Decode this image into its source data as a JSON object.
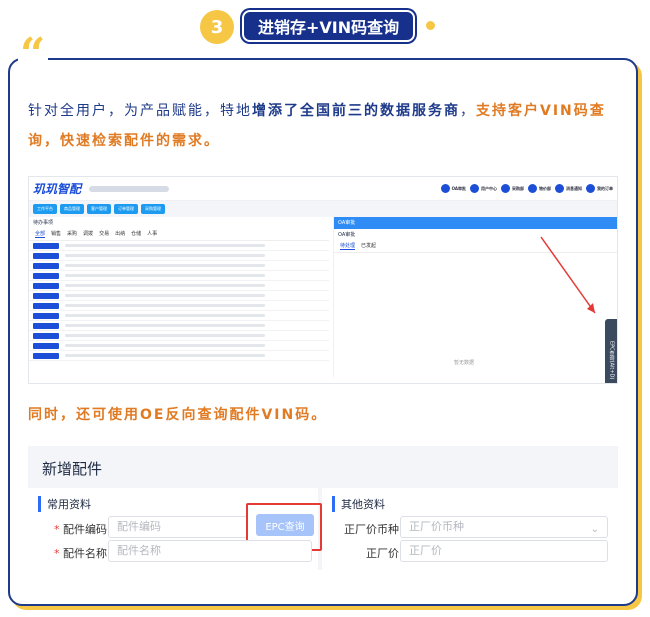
{
  "header": {
    "step_number": "3",
    "title": "进销存+VIN码查询"
  },
  "intro": {
    "part1": "针对全用户，为产品赋能，特地",
    "part2": "增添了全国前三的数据服务商",
    "part3": "，",
    "part4": "支持客户VIN码查询，快速检索配件的需求。"
  },
  "screenshot1": {
    "logo": "玑玑智配",
    "nav": [
      "OA审批",
      "用户中心",
      "采购部",
      "物价部",
      "消息通知",
      "我的订单"
    ],
    "quick_tabs": [
      "工作平台",
      "商品管理",
      "客户管理",
      "订单管理",
      "采购管理"
    ],
    "pending_title": "待办事项",
    "tabs": [
      "全部",
      "销售",
      "采购",
      "调拨",
      "交易",
      "出纳",
      "仓储",
      "人事"
    ],
    "oa_title": "OA审批",
    "oa_sub": "OA审批",
    "oa_tabs": [
      "待处理",
      "已发起"
    ],
    "empty_text": "暂无数据",
    "epc_label": "EPC查询(Alt+D)"
  },
  "line2": "同时，还可使用OE反向查询配件VIN码。",
  "form": {
    "title": "新增配件",
    "section_common": "常用资料",
    "section_other": "其他资料",
    "part_code_label": "配件编码",
    "part_code_placeholder": "配件编码",
    "part_name_label": "配件名称",
    "part_name_placeholder": "配件名称",
    "epc_button": "EPC查询",
    "currency_label": "正厂价币种",
    "currency_placeholder": "正厂价币种",
    "price_label": "正厂价",
    "price_placeholder": "正厂价"
  },
  "colors": {
    "navy": "#1e3a8a",
    "yellow": "#f6c744",
    "orange": "#e07b24",
    "red": "#e53935"
  }
}
